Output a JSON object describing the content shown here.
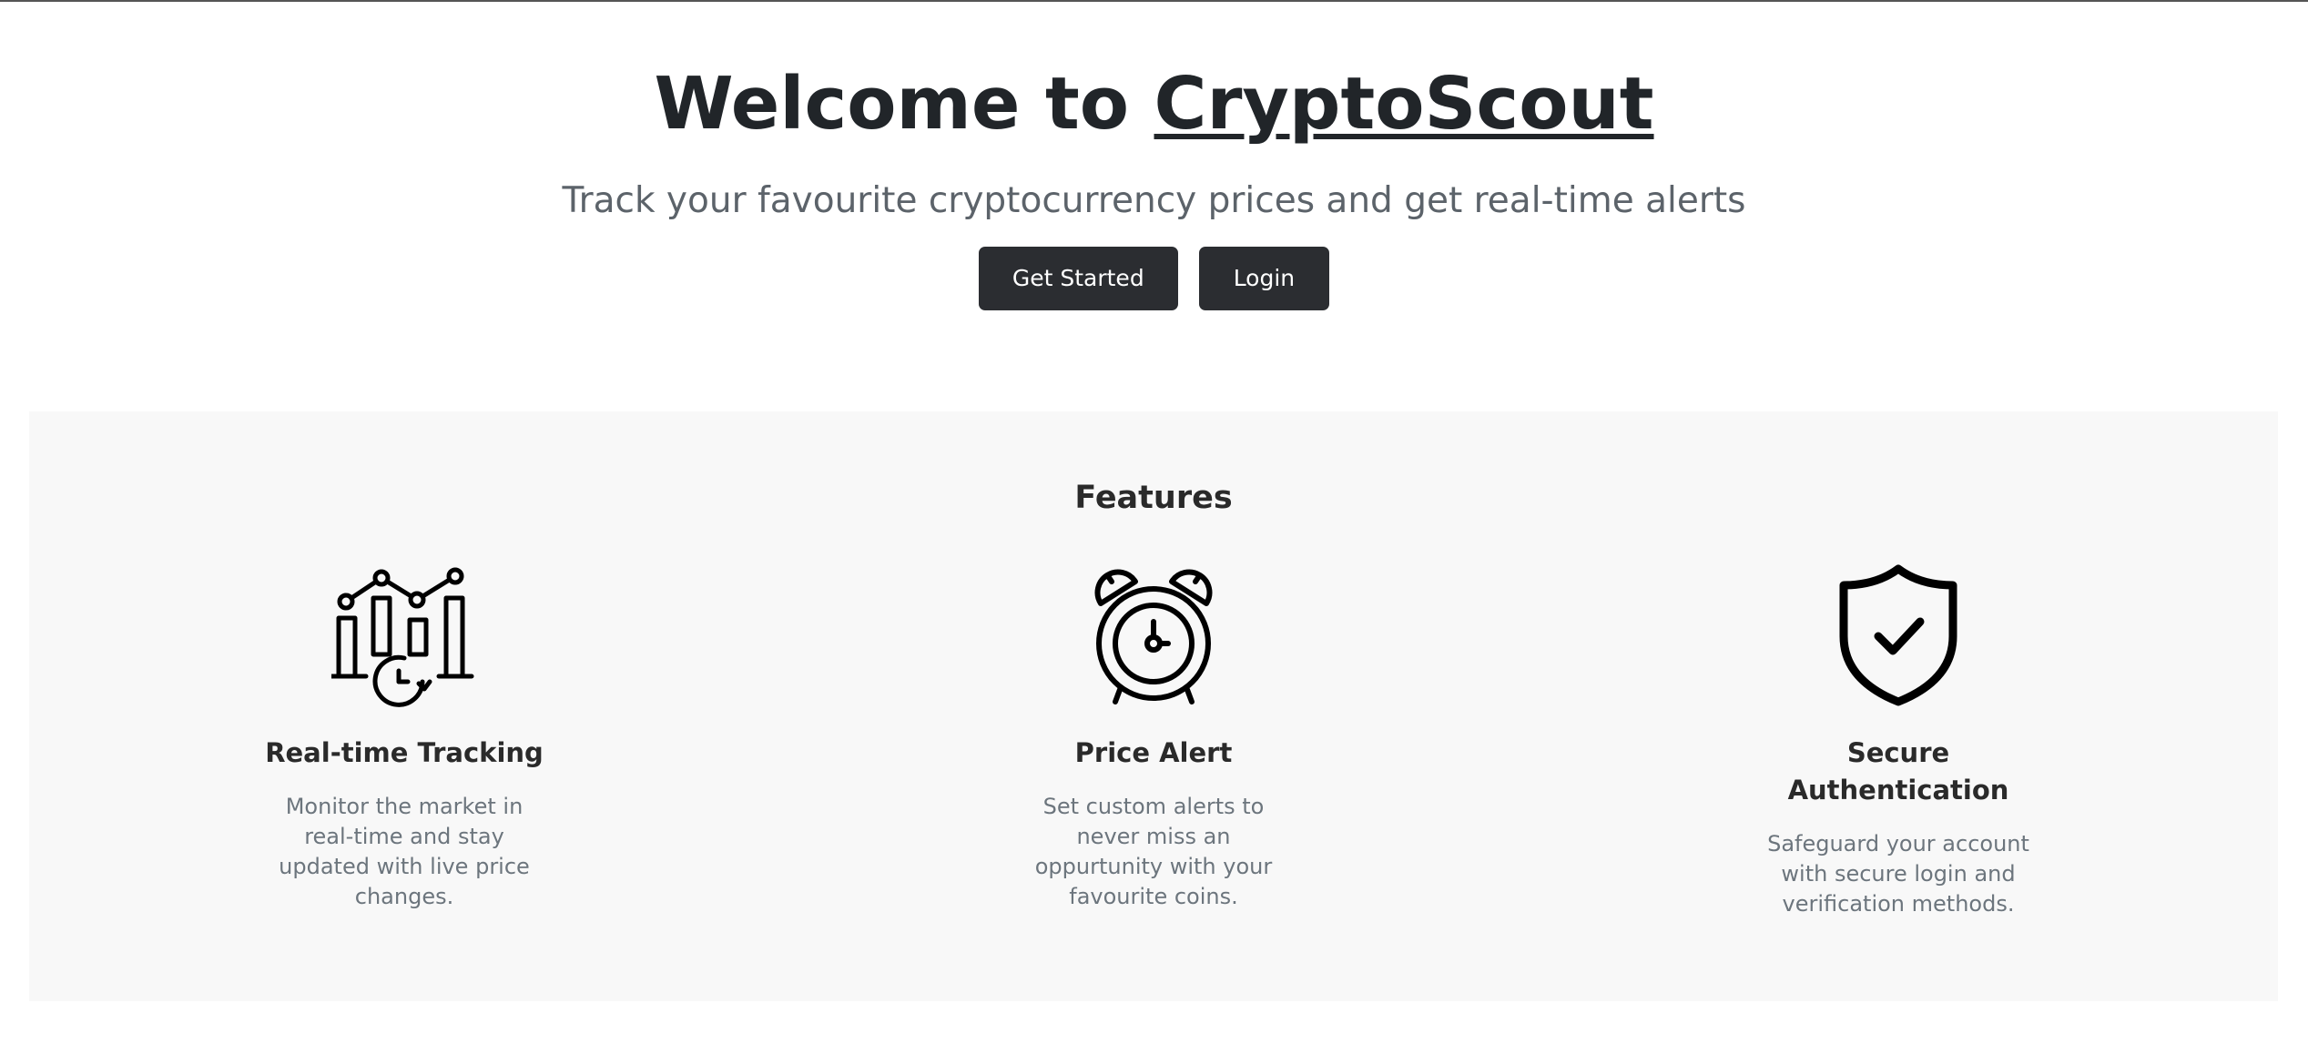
{
  "hero": {
    "title_prefix": "Welcome to ",
    "title_brand": "CryptoScout",
    "subtitle": "Track your favourite cryptocurrency prices and get real-time alerts",
    "get_started_label": "Get Started",
    "login_label": "Login"
  },
  "features": {
    "title": "Features",
    "items": [
      {
        "icon": "chart-clock-icon",
        "title": "Real-time Tracking",
        "description": "Monitor the market in real-time and stay updated with live price changes."
      },
      {
        "icon": "alarm-clock-icon",
        "title": "Price Alert",
        "description": "Set custom alerts to never miss an oppurtunity with your favourite coins."
      },
      {
        "icon": "shield-check-icon",
        "title": "Secure Authentication",
        "description": "Safeguard your account with secure login and verification methods."
      }
    ]
  },
  "colors": {
    "button_bg": "#2b2d31",
    "text_dark": "#212529",
    "text_muted": "#6c757d",
    "section_bg": "#f8f8f8"
  }
}
